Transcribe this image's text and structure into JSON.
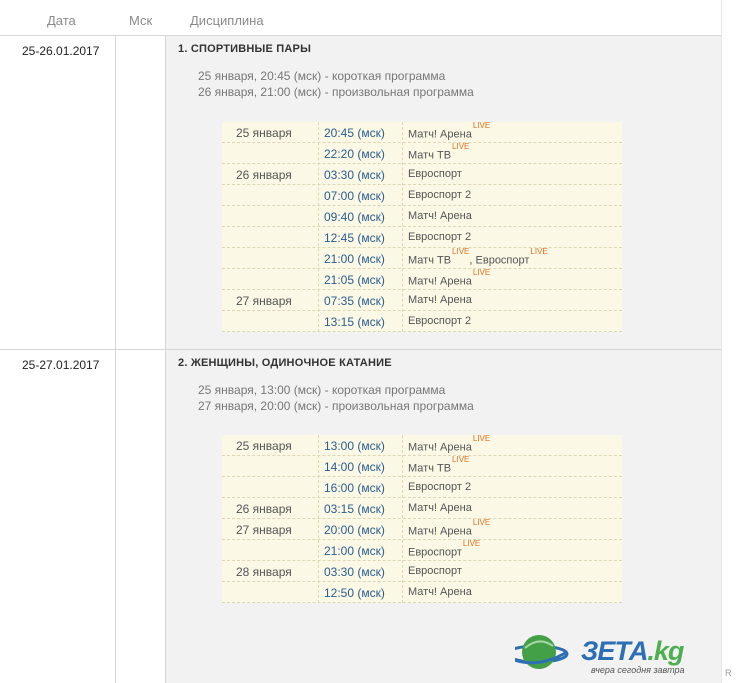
{
  "header": {
    "date": "Дата",
    "msk": "Мск",
    "discipline": "Дисциплина"
  },
  "events": [
    {
      "date": "25-26.01.2017",
      "title": "1. СПОРТИВНЫЕ ПАРЫ",
      "programs": [
        "25 января, 20:45 (мск) - короткая программа",
        "26 января, 21:00 (мск) - произвольная программа"
      ],
      "schedule": [
        {
          "day": "25 января",
          "time": "20:45 (мск)",
          "channels": [
            {
              "name": "Матч! Арена",
              "live": "LIVE"
            }
          ]
        },
        {
          "day": "",
          "time": "22:20 (мск)",
          "channels": [
            {
              "name": "Матч ТВ",
              "live": "LIVE"
            }
          ]
        },
        {
          "day": "26 января",
          "time": "03:30 (мск)",
          "channels": [
            {
              "name": "Евроспорт",
              "live": ""
            }
          ]
        },
        {
          "day": "",
          "time": "07:00 (мск)",
          "channels": [
            {
              "name": "Евроспорт 2",
              "live": ""
            }
          ]
        },
        {
          "day": "",
          "time": "09:40 (мск)",
          "channels": [
            {
              "name": "Матч! Арена",
              "live": ""
            }
          ]
        },
        {
          "day": "",
          "time": "12:45 (мск)",
          "channels": [
            {
              "name": "Евроспорт 2",
              "live": ""
            }
          ]
        },
        {
          "day": "",
          "time": "21:00 (мск)",
          "channels": [
            {
              "name": "Матч ТВ",
              "live": "LIVE"
            },
            {
              "name": "Евроспорт",
              "live": "LIVE"
            }
          ]
        },
        {
          "day": "",
          "time": "21:05 (мск)",
          "channels": [
            {
              "name": "Матч! Арена",
              "live": "LIVE"
            }
          ]
        },
        {
          "day": "27 января",
          "time": "07:35 (мск)",
          "channels": [
            {
              "name": "Матч! Арена",
              "live": ""
            }
          ]
        },
        {
          "day": "",
          "time": "13:15 (мск)",
          "channels": [
            {
              "name": "Евроспорт 2",
              "live": ""
            }
          ]
        }
      ]
    },
    {
      "date": "25-27.01.2017",
      "title": "2. ЖЕНЩИНЫ, ОДИНОЧНОЕ КАТАНИЕ",
      "programs": [
        "25 января, 13:00 (мск) - короткая программа",
        "27 января, 20:00 (мск) - произвольная программа"
      ],
      "schedule": [
        {
          "day": "25 января",
          "time": "13:00 (мск)",
          "channels": [
            {
              "name": "Матч! Арена",
              "live": "LIVE"
            }
          ]
        },
        {
          "day": "",
          "time": "14:00 (мск)",
          "channels": [
            {
              "name": "Матч ТВ",
              "live": "LIVE"
            }
          ]
        },
        {
          "day": "",
          "time": "16:00 (мск)",
          "channels": [
            {
              "name": "Евроспорт 2",
              "live": ""
            }
          ]
        },
        {
          "day": "26 января",
          "time": "03:15 (мск)",
          "channels": [
            {
              "name": "Матч! Арена",
              "live": ""
            }
          ]
        },
        {
          "day": "27 января",
          "time": "20:00 (мск)",
          "channels": [
            {
              "name": "Матч! Арена",
              "live": "LIVE"
            }
          ]
        },
        {
          "day": "",
          "time": "21:00 (мск)",
          "channels": [
            {
              "name": "Евроспорт",
              "live": "LIVE"
            }
          ]
        },
        {
          "day": "28 января",
          "time": "03:30 (мск)",
          "channels": [
            {
              "name": "Евроспорт",
              "live": ""
            }
          ]
        },
        {
          "day": "",
          "time": "12:50 (мск)",
          "channels": [
            {
              "name": "Матч! Арена",
              "live": ""
            }
          ]
        }
      ]
    }
  ],
  "watermark": {
    "brand": "ЗЕТА",
    "tld": ".kg",
    "tagline": "вчера сегодня завтра",
    "mark": "R"
  },
  "colors": {
    "time": "#2a5d8f",
    "live": "#e07020",
    "schedule_bg": "#fbf8e6",
    "section_bg": "#f2f2f2"
  }
}
